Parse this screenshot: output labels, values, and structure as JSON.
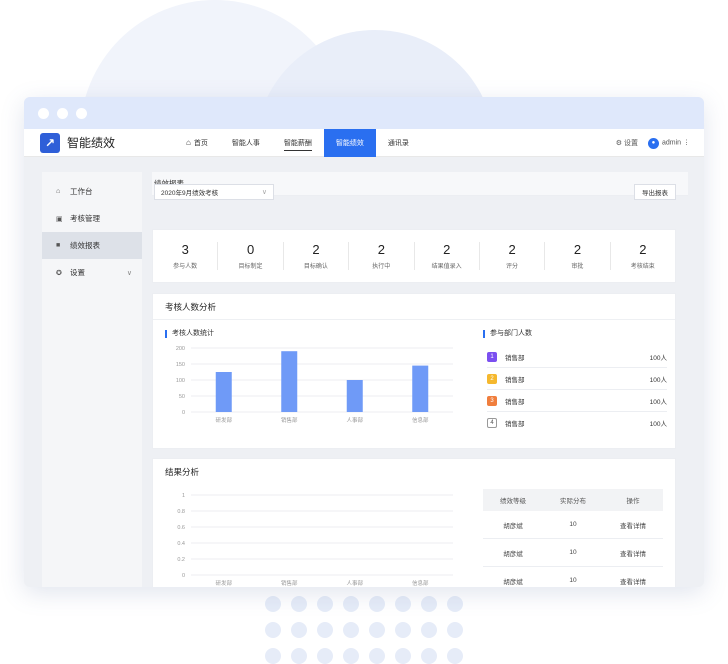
{
  "app": {
    "name": "智能绩效",
    "logo_glyph": "↗"
  },
  "topnav": {
    "items": [
      {
        "label": "首页",
        "state": "normal"
      },
      {
        "label": "智能人事",
        "state": "normal"
      },
      {
        "label": "智能薪酬",
        "state": "underline"
      },
      {
        "label": "智能绩效",
        "state": "active"
      },
      {
        "label": "通讯录",
        "state": "normal"
      }
    ],
    "settings_label": "设置",
    "user": "admin"
  },
  "sidebar": {
    "items": [
      {
        "label": "工作台",
        "icon": "home-icon"
      },
      {
        "label": "考核管理",
        "icon": "clipboard-icon"
      },
      {
        "label": "绩效报表",
        "icon": "report-icon",
        "active": true
      },
      {
        "label": "设置",
        "icon": "gear-icon",
        "expandable": true
      }
    ]
  },
  "page": {
    "header": "绩效报表",
    "period_select": "2020年9月绩效考核",
    "export_label": "导出报表"
  },
  "stats": [
    {
      "value": "3",
      "label": "参与人数"
    },
    {
      "value": "0",
      "label": "目标制定"
    },
    {
      "value": "2",
      "label": "目标确认"
    },
    {
      "value": "2",
      "label": "执行中"
    },
    {
      "value": "2",
      "label": "结果值录入"
    },
    {
      "value": "2",
      "label": "评分"
    },
    {
      "value": "2",
      "label": "审批"
    },
    {
      "value": "2",
      "label": "考核结束"
    }
  ],
  "analysis": {
    "title": "考核人数分析",
    "chart_title": "考核人数统计",
    "dept_title": "参与部门人数",
    "departments": [
      {
        "rank": "1",
        "name": "销售部",
        "count": "100人",
        "color": "#7b4ff0"
      },
      {
        "rank": "2",
        "name": "销售部",
        "count": "100人",
        "color": "#f5b82e"
      },
      {
        "rank": "3",
        "name": "销售部",
        "count": "100人",
        "color": "#f07e3d"
      },
      {
        "rank": "4",
        "name": "销售部",
        "count": "100人",
        "color": "outline"
      }
    ]
  },
  "result": {
    "title": "结果分析",
    "table_headers": [
      "绩效等级",
      "实际分布",
      "操作"
    ],
    "rows": [
      {
        "grade": "胡彦斌",
        "dist": "10",
        "action": "查看详情"
      },
      {
        "grade": "胡彦斌",
        "dist": "10",
        "action": "查看详情"
      },
      {
        "grade": "胡彦斌",
        "dist": "10",
        "action": "查看详情"
      }
    ]
  },
  "chart_data": [
    {
      "type": "bar",
      "title": "考核人数统计",
      "categories": [
        "研发部",
        "销售部",
        "人事部",
        "信息部"
      ],
      "values": [
        125,
        190,
        100,
        145
      ],
      "ylim": [
        0,
        200
      ],
      "yticks": [
        "200",
        "150",
        "100",
        "50",
        "0"
      ],
      "bar_color": "#6f9af7",
      "grid": true
    },
    {
      "type": "line",
      "title": "结果分析",
      "categories": [
        "研发部",
        "销售部",
        "人事部",
        "信息部"
      ],
      "values": [],
      "ylim": [
        0,
        1
      ],
      "yticks": [
        "1",
        "0.8",
        "0.6",
        "0.4",
        "0.2",
        "0"
      ],
      "grid": true
    }
  ]
}
